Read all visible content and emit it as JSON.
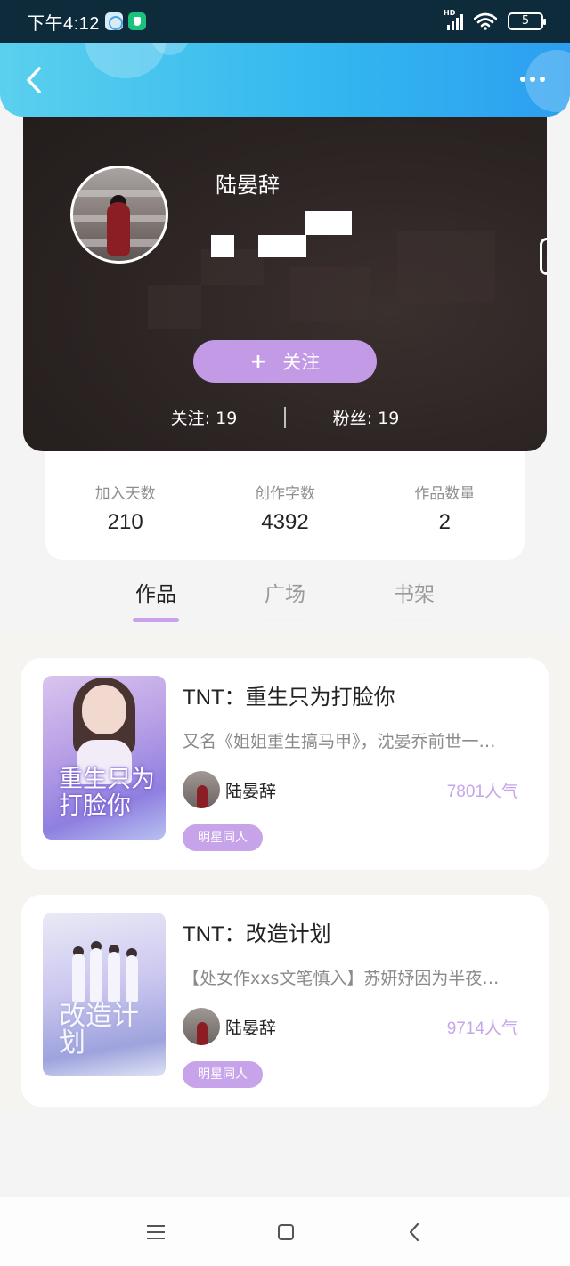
{
  "status_bar": {
    "time": "下午4:12",
    "network_label": "HD",
    "battery": "5"
  },
  "header": {
    "back_icon": "chevron-left-icon",
    "more_icon": "more-dots-icon"
  },
  "profile": {
    "username": "陆晏辞",
    "follow_button_label": "关注",
    "follow_button_icon": "+",
    "following_label": "关注",
    "following_count": "19",
    "fans_label": "粉丝",
    "fans_count": "19"
  },
  "stats": [
    {
      "label": "加入天数",
      "value": "210"
    },
    {
      "label": "创作字数",
      "value": "4392"
    },
    {
      "label": "作品数量",
      "value": "2"
    }
  ],
  "tabs": [
    {
      "label": "作品",
      "active": true
    },
    {
      "label": "广场",
      "active": false
    },
    {
      "label": "书架",
      "active": false
    }
  ],
  "works": [
    {
      "title": "TNT：重生只为打脸你",
      "description": "又名《姐姐重生搞马甲》，沈晏乔前世一…",
      "cover_text": "重生只为打脸你",
      "author": "陆晏辞",
      "popularity": "7801人气",
      "tag": "明星同人"
    },
    {
      "title": "TNT：改造计划",
      "description": "【处女作xxs文笔慎入】苏妍妤因为半夜…",
      "cover_text": "改造计划",
      "author": "陆晏辞",
      "popularity": "9714人气",
      "tag": "明星同人"
    }
  ],
  "colors": {
    "header_gradient_start": "#5bd0ee",
    "header_gradient_end": "#2c9ff0",
    "accent_purple": "#c39ae6",
    "popularity_text": "#c6a6ea"
  }
}
